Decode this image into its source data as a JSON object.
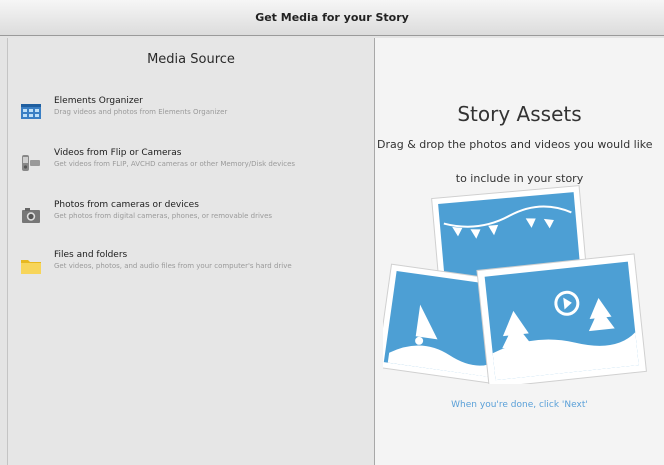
{
  "window": {
    "title": "Get Media for your Story"
  },
  "media_source": {
    "title": "Media Source",
    "items": [
      {
        "title": "Elements Organizer",
        "description": "Drag videos and photos from Elements Organizer",
        "icon": "organizer-icon"
      },
      {
        "title": "Videos from Flip or Cameras",
        "description": "Get videos from FLIP, AVCHD cameras or other Memory/Disk devices",
        "icon": "camcorder-icon"
      },
      {
        "title": "Photos from cameras or devices",
        "description": "Get photos from digital cameras, phones, or removable drives",
        "icon": "camera-icon"
      },
      {
        "title": "Files and folders",
        "description": "Get videos, photos, and audio files from your computer's hard drive",
        "icon": "folder-icon"
      }
    ]
  },
  "story_assets": {
    "title": "Story Assets",
    "description_line1": "Drag & drop the photos and videos you would like",
    "description_line2": "to include in your story",
    "footer": "When you're done, click 'Next'"
  },
  "colors": {
    "accent": "#5aa0d8",
    "photo_blue": "#4d9fd4"
  }
}
